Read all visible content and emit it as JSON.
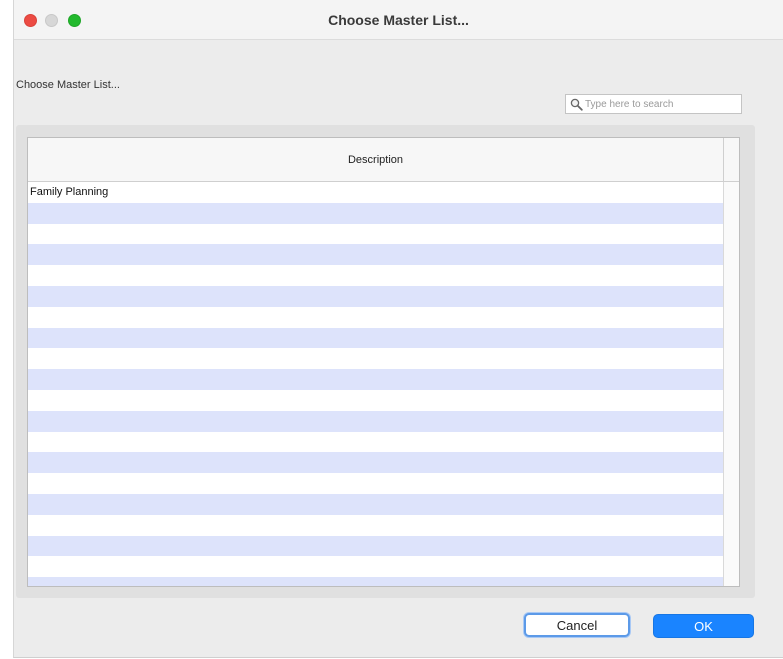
{
  "window": {
    "title": "Choose Master List..."
  },
  "prompt_label": "Choose Master List...",
  "search": {
    "placeholder": "Type here to search",
    "value": ""
  },
  "table": {
    "columns": [
      "Description"
    ],
    "rows": [
      "Family Planning",
      "",
      "",
      "",
      "",
      "",
      "",
      "",
      "",
      "",
      "",
      "",
      "",
      "",
      "",
      "",
      "",
      "",
      "",
      ""
    ]
  },
  "buttons": {
    "cancel": "Cancel",
    "ok": "OK"
  },
  "colors": {
    "accent": "#1a84ff",
    "row_stripe": "#dde3fb",
    "close": "#ec4b43",
    "zoom": "#22b92d"
  },
  "icons": {
    "search": "magnifier-icon"
  }
}
